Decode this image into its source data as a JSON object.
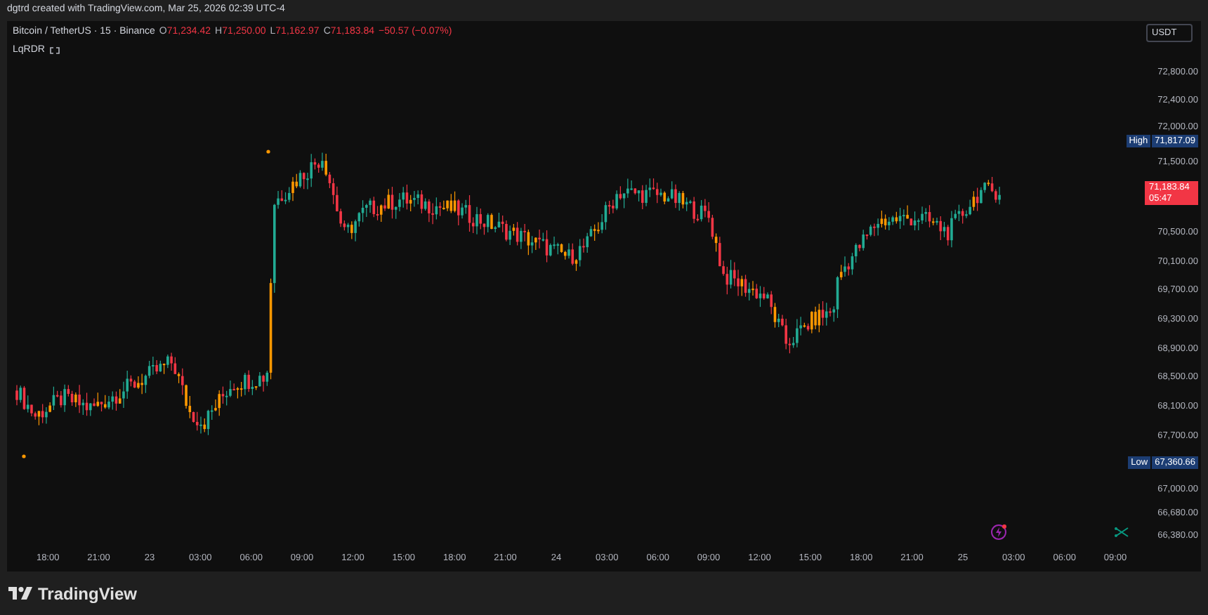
{
  "header": {
    "text": "dgtrd created with TradingView.com, Mar 25, 2026 02:39 UTC-4"
  },
  "legend": {
    "symbol": "Bitcoin / TetherUS · 15 · Binance",
    "ohlc": [
      {
        "key": "O",
        "value": "71,234.42"
      },
      {
        "key": "H",
        "value": "71,250.00"
      },
      {
        "key": "L",
        "value": "71,162.97"
      },
      {
        "key": "C",
        "value": "71,183.84"
      }
    ],
    "change": "−50.57 (−0.07%)",
    "indicator": "LqRDR"
  },
  "price_axis": {
    "currency": "USDT",
    "ticks": [
      "72,800.00",
      "72,400.00",
      "72,000.00",
      "71,500.00",
      "70,500.00",
      "70,100.00",
      "69,700.00",
      "69,300.00",
      "68,900.00",
      "68,500.00",
      "68,100.00",
      "67,700.00",
      "67,000.00",
      "66,680.00",
      "66,380.00"
    ],
    "high": {
      "label": "High",
      "value": "71,817.09"
    },
    "low": {
      "label": "Low",
      "value": "67,360.66"
    },
    "last": {
      "value": "71,183.84",
      "countdown": "05:47"
    }
  },
  "time_axis": [
    "18:00",
    "21:00",
    "23",
    "03:00",
    "06:00",
    "09:00",
    "12:00",
    "15:00",
    "18:00",
    "21:00",
    "24",
    "03:00",
    "06:00",
    "09:00",
    "12:00",
    "15:00",
    "18:00",
    "21:00",
    "25",
    "03:00",
    "06:00",
    "09:00"
  ],
  "footer": {
    "brand": "TradingView"
  }
}
